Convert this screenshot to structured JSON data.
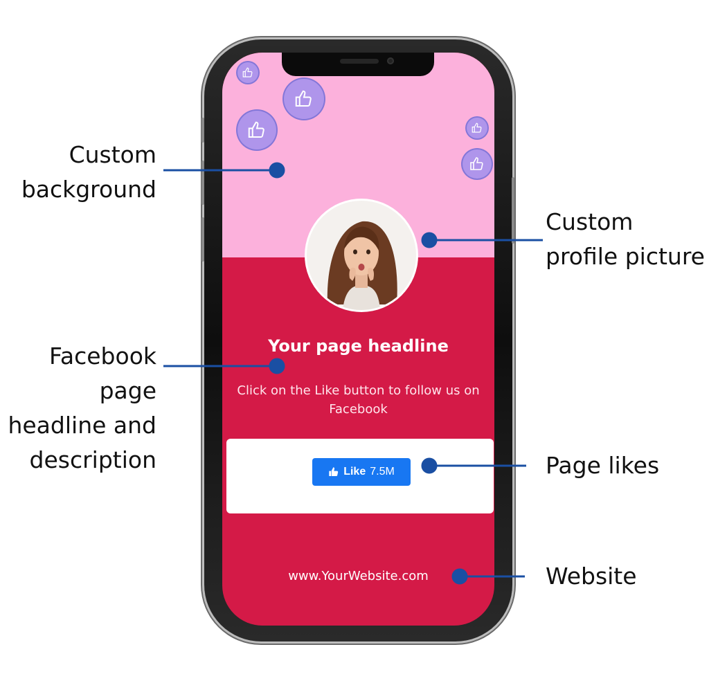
{
  "callouts": {
    "background": [
      "Custom",
      "background"
    ],
    "profile_picture": [
      "Custom",
      "profile picture"
    ],
    "headline": [
      "Facebook",
      "page",
      "headline and",
      "description"
    ],
    "likes": [
      "Page likes"
    ],
    "website": [
      "Website"
    ]
  },
  "screen": {
    "headline": "Your page headline",
    "description": "Click on the Like button to follow us on Facebook",
    "like_button": {
      "label": "Like",
      "count": "7.5M"
    },
    "website": "www.YourWebsite.com"
  },
  "icons": {
    "bubbles": "thumbs-up-icon",
    "like_button": "thumbs-up-icon",
    "profile": "woman-portrait"
  },
  "colors": {
    "top_background": "#fcb1dc",
    "bottom_background": "#d41a47",
    "connector": "#1a4fa3",
    "like_button": "#1877f2"
  }
}
